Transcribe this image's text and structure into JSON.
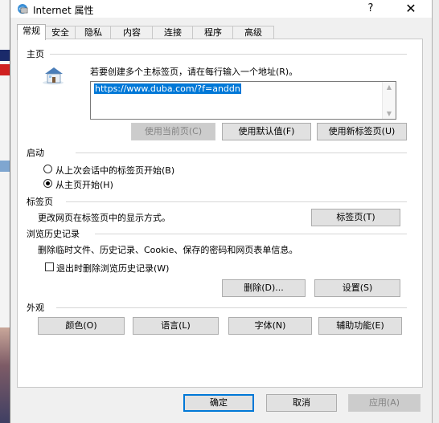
{
  "window": {
    "title": "Internet 属性",
    "help_glyph": "?",
    "close_glyph": "✕"
  },
  "tabs": [
    {
      "label": "常规",
      "active": true
    },
    {
      "label": "安全"
    },
    {
      "label": "隐私"
    },
    {
      "label": "内容"
    },
    {
      "label": "连接"
    },
    {
      "label": "程序"
    },
    {
      "label": "高级"
    }
  ],
  "homepage": {
    "section_label": "主页",
    "instruction": "若要创建多个主标签页，请在每行输入一个地址(R)。",
    "url_value": "https://www.duba.com/?f=anddn",
    "buttons": {
      "use_current": "使用当前页(C)",
      "use_default": "使用默认值(F)",
      "use_new_tab": "使用新标签页(U)"
    }
  },
  "startup": {
    "section_label": "启动",
    "options": [
      {
        "label": "从上次会话中的标签页开始(B)",
        "selected": false
      },
      {
        "label": "从主页开始(H)",
        "selected": true
      }
    ]
  },
  "tabs_section": {
    "section_label": "标签页",
    "description": "更改网页在标签页中的显示方式。",
    "button": "标签页(T)"
  },
  "history": {
    "section_label": "浏览历史记录",
    "description": "删除临时文件、历史记录、Cookie、保存的密码和网页表单信息。",
    "checkbox_label": "退出时删除浏览历史记录(W)",
    "checkbox_checked": false,
    "delete_button": "删除(D)...",
    "settings_button": "设置(S)"
  },
  "appearance": {
    "section_label": "外观",
    "buttons": [
      "颜色(O)",
      "语言(L)",
      "字体(N)",
      "辅助功能(E)"
    ]
  },
  "footer": {
    "ok": "确定",
    "cancel": "取消",
    "apply": "应用(A)"
  },
  "colors": {
    "selection": "#0078d7",
    "dialog_bg": "#f0f0f0",
    "panel_bg": "#ffffff"
  }
}
